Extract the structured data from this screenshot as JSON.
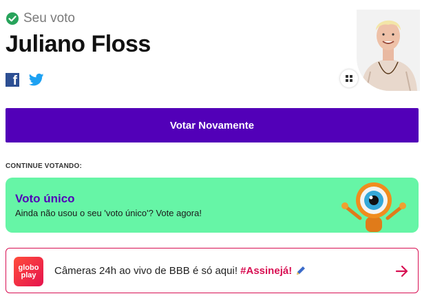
{
  "vote": {
    "status_label": "Seu voto",
    "candidate_name": "Juliano Floss"
  },
  "share": {
    "facebook_glyph": "f",
    "icons": [
      "facebook-icon",
      "twitter-icon"
    ]
  },
  "actions": {
    "vote_again_label": "Votar Novamente"
  },
  "continue_section": {
    "label": "CONTINUE VOTANDO:",
    "unique_vote": {
      "title": "Voto único",
      "text": "Ainda não usou o seu 'voto único'? Vote agora!"
    }
  },
  "globoplay_banner": {
    "logo_line1": "globo",
    "logo_line2": "play",
    "text": "Câmeras 24h ao vivo de BBB é só aqui! ",
    "hashtag": "#Assinejá!"
  },
  "colors": {
    "primary_purple": "#5200b8",
    "card_green": "#66f5a6",
    "globoplay_red": "#d80f52",
    "check_green": "#27a35b"
  }
}
